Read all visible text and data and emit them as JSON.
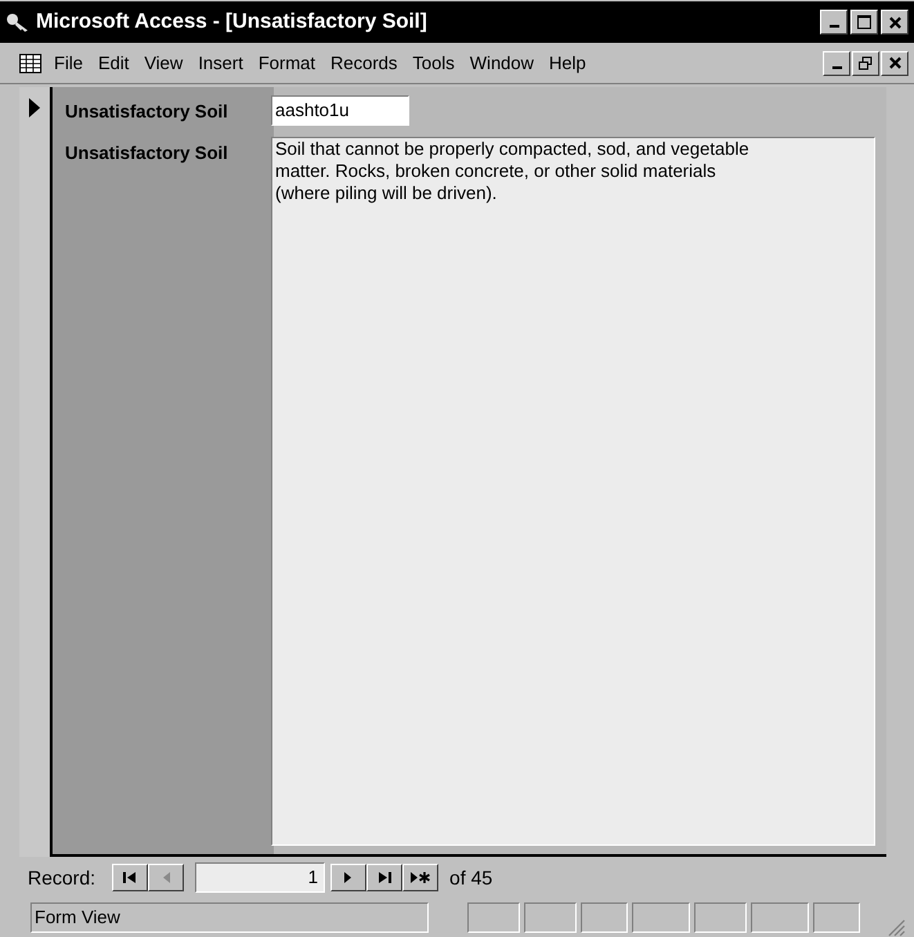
{
  "window": {
    "title": "Microsoft Access - [Unsatisfactory Soil]"
  },
  "menu": [
    "File",
    "Edit",
    "View",
    "Insert",
    "Format",
    "Records",
    "Tools",
    "Window",
    "Help"
  ],
  "form": {
    "current_record": true,
    "fields": [
      {
        "kind": "textbox",
        "label": "Unsatisfactory Soil",
        "value": "aashto1u"
      },
      {
        "kind": "memo",
        "label": "Unsatisfactory Soil",
        "value": "Soil that cannot be properly compacted, sod, and vegetable matter. Rocks, broken concrete, or other solid materials  (where piling will be driven)."
      }
    ]
  },
  "navigation": {
    "label": "Record:",
    "record": "1",
    "count": "of 45",
    "buttons": [
      {
        "kind": "first",
        "disabled": false
      },
      {
        "kind": "prev",
        "disabled": true
      },
      {
        "kind": "next",
        "disabled": false
      },
      {
        "kind": "last",
        "disabled": false
      },
      {
        "kind": "new",
        "disabled": false
      }
    ]
  },
  "status_bar": {
    "text": "Form View"
  }
}
